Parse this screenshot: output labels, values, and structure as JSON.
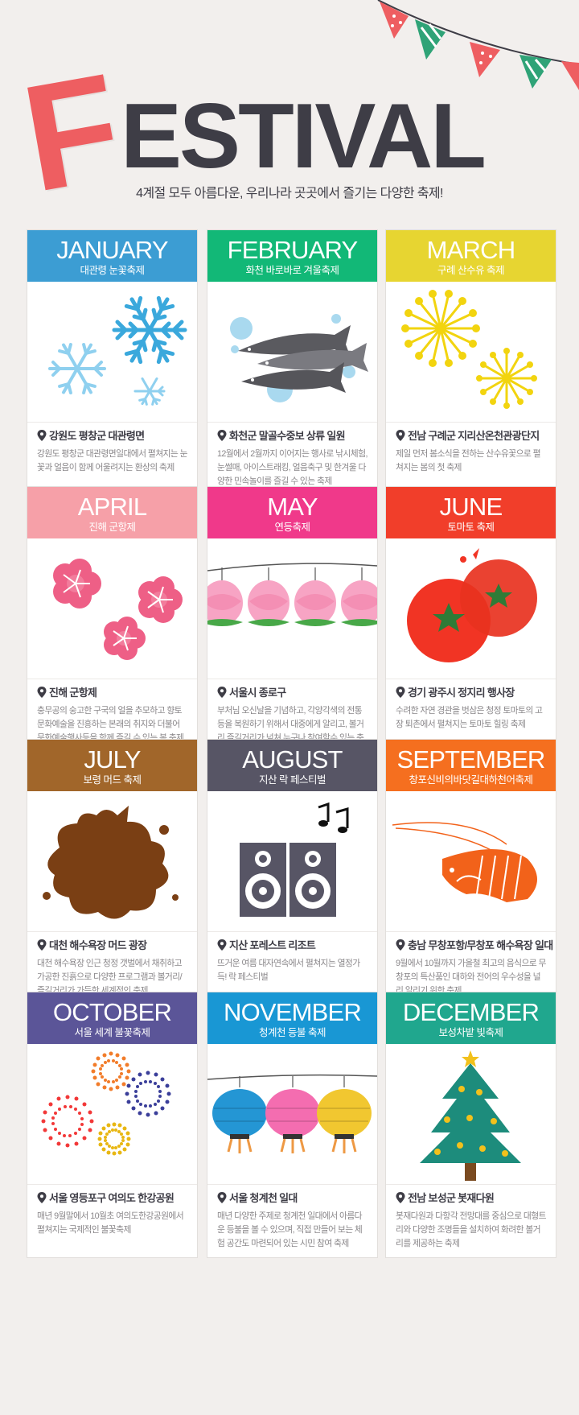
{
  "header": {
    "letter_f": "F",
    "title_rest": "ESTIVAL",
    "subtitle": "4계절 모두 아름다운, 우리나라 곳곳에서 즐기는 다양한 축제!"
  },
  "colors": {
    "background": "#f2efed",
    "title": "#3e3d46",
    "f_letter": "#ee5e61"
  },
  "months": [
    {
      "month": "JANUARY",
      "festival": "대관령 눈꽃축제",
      "color": "#3c9dd3",
      "icon": "snowflake-icon",
      "location": "강원도 평창군 대관령면",
      "description": "강원도 평창군 대관령면일대에서 펼쳐지는 눈꽃과 얼음이 함께 어울려지는 환상의 축제"
    },
    {
      "month": "FEBRUARY",
      "festival": "화천 바로바로 겨울축제",
      "color": "#12b877",
      "icon": "fish-icon",
      "location": "화천군 말골수중보 상류 일원",
      "description": "12월에서 2월까지 이어지는 행사로 낚시체험, 눈썰매, 아이스트래킹, 얼음축구 및 한겨울 다양한 민속놀이를 즐길 수 있는 축제"
    },
    {
      "month": "MARCH",
      "festival": "구례 산수유 축제",
      "color": "#e7d531",
      "icon": "sansuyu-flower-icon",
      "location": "전남 구례군 지리산온천관광단지",
      "description": "제일 먼저 봄소식을 전하는 산수유꽃으로 펼쳐지는 봄의 첫 축제"
    },
    {
      "month": "APRIL",
      "festival": "진해 군항제",
      "color": "#f6a0a8",
      "icon": "cherry-blossom-icon",
      "location": "진해 군항제",
      "description": "충무공의 숭고한 구국의 얼을 추모하고 향토 문화예술을 진흥하는 본래의 취지와 더불어 문화예술행사등을 함께 즐길 수 있는 봄 축제"
    },
    {
      "month": "MAY",
      "festival": "연등축제",
      "color": "#f0398a",
      "icon": "lotus-lantern-icon",
      "location": "서울시 종로구",
      "description": "부처님 오신날을 기념하고, 각양각색의 전통등을 복원하기 위해서 대중에게 알리고, 볼거리 즐길거리가 넘쳐 누구나 참여할수 있는 축제"
    },
    {
      "month": "JUNE",
      "festival": "토마토 축제",
      "color": "#f13e2a",
      "icon": "tomato-icon",
      "location": "경기 광주시 정지리 행사장",
      "description": "수려한 자연 경관을 벗삼은 청정 토마토의 고장 퇴촌에서 펼쳐지는 토마토 힐링 축제"
    },
    {
      "month": "JULY",
      "festival": "보령 머드 축제",
      "color": "#a1662a",
      "icon": "mud-splash-icon",
      "location": "대천 해수욕장 머드 광장",
      "description": "대천 해수욕장 인근 청정 갯벌에서 채취하고 가공한 진흙으로 다양한 프로그램과 볼거리/즐길거리가 가득한 세계적인 축제"
    },
    {
      "month": "AUGUST",
      "festival": "지산 락 페스티벌",
      "color": "#575565",
      "icon": "speaker-icon",
      "location": "지산 포레스트 리조트",
      "description": "뜨거운 여름 대자연속에서 펼쳐지는 열정가득! 락 페스티벌"
    },
    {
      "month": "SEPTEMBER",
      "festival": "창포신비의바닷길대하천어축제",
      "color": "#f56f1f",
      "icon": "shrimp-icon",
      "location": "충남 무창포항/무창포 해수욕장 일대",
      "description": "9월에서 10월까지 가을철 최고의 음식으로 무창포의 특산품인 대하와 전어의 우수성을 널리 알리기 위한 축제"
    },
    {
      "month": "OCTOBER",
      "festival": "서울 세계 불꽃축제",
      "color": "#5b5598",
      "icon": "fireworks-icon",
      "location": "서울 영등포구 여의도 한강공원",
      "description": "매년 9월말에서 10월초 여의도한강공원에서 펼쳐지는 국제적인 불꽃축제"
    },
    {
      "month": "NOVEMBER",
      "festival": "청계천 등불 축제",
      "color": "#1997d4",
      "icon": "paper-lantern-icon",
      "location": "서울 청계천 일대",
      "description": "매년 다양한 주제로 청계천 일대에서 아름다운 등불을 볼 수 있으며, 직접 만들어 보는 체험 공간도 마련되어 있는 시민 참여 축제"
    },
    {
      "month": "DECEMBER",
      "festival": "보성차밭 빛축제",
      "color": "#20a78e",
      "icon": "christmas-tree-icon",
      "location": "전남 보성군 봇재다원",
      "description": "봇재다원과 다항각 전망대를 중심으로 대형트리와 다양한 조명들을 설치하여 화려한 볼거리를 제공하는 축제"
    }
  ]
}
